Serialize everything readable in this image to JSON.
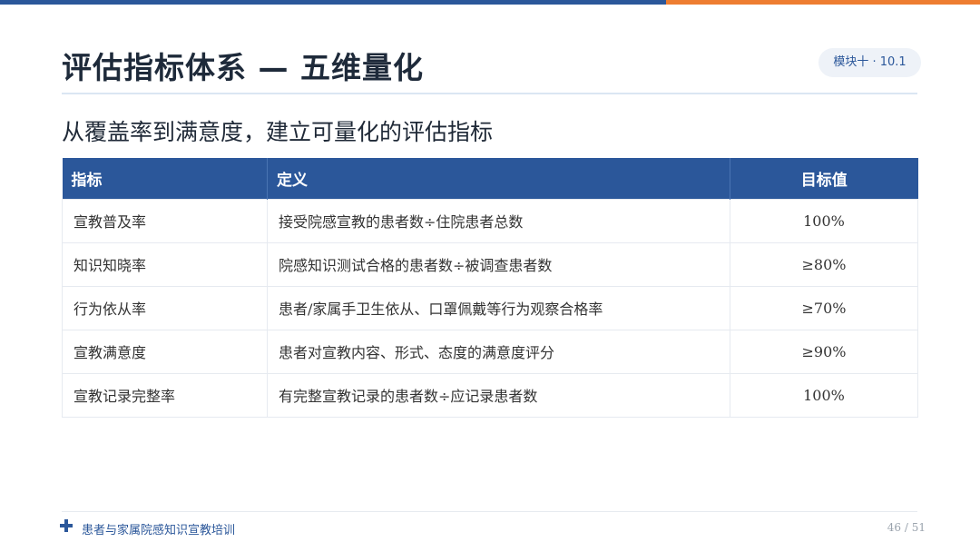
{
  "colors": {
    "primary": "#2b579a",
    "accent": "#ee7d31",
    "badge_bg": "#eef2f8"
  },
  "header": {
    "title": "评估指标体系 — 五维量化",
    "badge": "模块十 · 10.1"
  },
  "subtitle": "从覆盖率到满意度，建立可量化的评估指标",
  "table": {
    "columns": [
      "指标",
      "定义",
      "目标值"
    ],
    "rows": [
      {
        "metric": "宣教普及率",
        "definition": "接受院感宣教的患者数÷住院患者总数",
        "target": "100%"
      },
      {
        "metric": "知识知晓率",
        "definition": "院感知识测试合格的患者数÷被调查患者数",
        "target": "≥80%"
      },
      {
        "metric": "行为依从率",
        "definition": "患者/家属手卫生依从、口罩佩戴等行为观察合格率",
        "target": "≥70%"
      },
      {
        "metric": "宣教满意度",
        "definition": "患者对宣教内容、形式、态度的满意度评分",
        "target": "≥90%"
      },
      {
        "metric": "宣教记录完整率",
        "definition": "有完整宣教记录的患者数÷应记录患者数",
        "target": "100%"
      }
    ]
  },
  "footer": {
    "icon": "plus-icon",
    "text": "患者与家属院感知识宣教培训",
    "page": "46 / 51"
  }
}
